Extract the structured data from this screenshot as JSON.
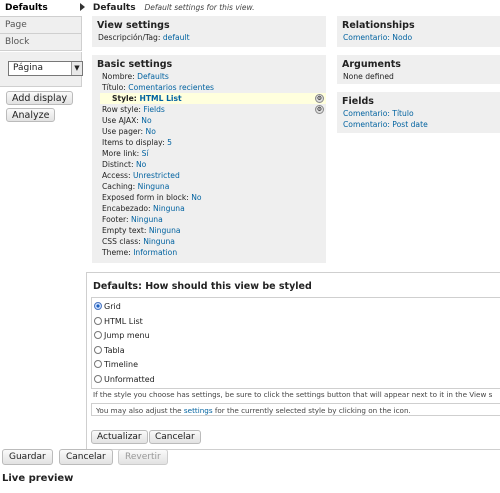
{
  "left_tabs": [
    "Defaults",
    "Page",
    "Block"
  ],
  "display_select": "Página",
  "buttons": {
    "add_display": "Add display",
    "analyze": "Analyze"
  },
  "header": {
    "title": "Defaults",
    "subtitle": "Default settings for this view."
  },
  "view_settings": {
    "title": "View settings",
    "label": "Descripción/Tag:",
    "value": "default"
  },
  "basic_settings": {
    "title": "Basic settings",
    "rows": [
      {
        "label": "Nombre:",
        "value": "Defaults"
      },
      {
        "label": "Título:",
        "value": "Comentarios recientes"
      },
      {
        "label": "Style:",
        "value": "HTML List",
        "highlight": true
      },
      {
        "label": "Row style:",
        "value": "Fields"
      },
      {
        "label": "Use AJAX:",
        "value": "No"
      },
      {
        "label": "Use pager:",
        "value": "No"
      },
      {
        "label": "Items to display:",
        "value": "5"
      },
      {
        "label": "More link:",
        "value": "Sí"
      },
      {
        "label": "Distinct:",
        "value": "No"
      },
      {
        "label": "Access:",
        "value": "Unrestricted"
      },
      {
        "label": "Caching:",
        "value": "Ninguna"
      },
      {
        "label": "Exposed form in block:",
        "value": "No"
      },
      {
        "label": "Encabezado:",
        "value": "Ninguna"
      },
      {
        "label": "Footer:",
        "value": "Ninguna"
      },
      {
        "label": "Empty text:",
        "value": "Ninguna"
      },
      {
        "label": "CSS class:",
        "value": "Ninguna"
      },
      {
        "label": "Theme:",
        "value": "Information"
      }
    ]
  },
  "relationships": {
    "title": "Relationships",
    "items": [
      "Comentario: Nodo"
    ]
  },
  "arguments": {
    "title": "Arguments",
    "items": [
      "None defined"
    ]
  },
  "fields": {
    "title": "Fields",
    "items": [
      "Comentario: Título",
      "Comentario: Post date"
    ]
  },
  "style_form": {
    "title": "Defaults: How should this view be styled",
    "options": [
      "Grid",
      "HTML List",
      "Jump menu",
      "Tabla",
      "Timeline",
      "Unformatted"
    ],
    "selected": "Grid",
    "help_text": "If the style you choose has settings, be sure to click the settings button that will appear next to it in the View s",
    "adjust_prefix": "You may also adjust the ",
    "adjust_link": "settings",
    "adjust_suffix": " for the currently selected style by clicking on the icon.",
    "update_label": "Actualizar",
    "cancel_label": "Cancelar"
  },
  "bottom_buttons": {
    "save": "Guardar",
    "cancel": "Cancelar",
    "revert": "Revertir"
  },
  "live_preview": "Live preview"
}
